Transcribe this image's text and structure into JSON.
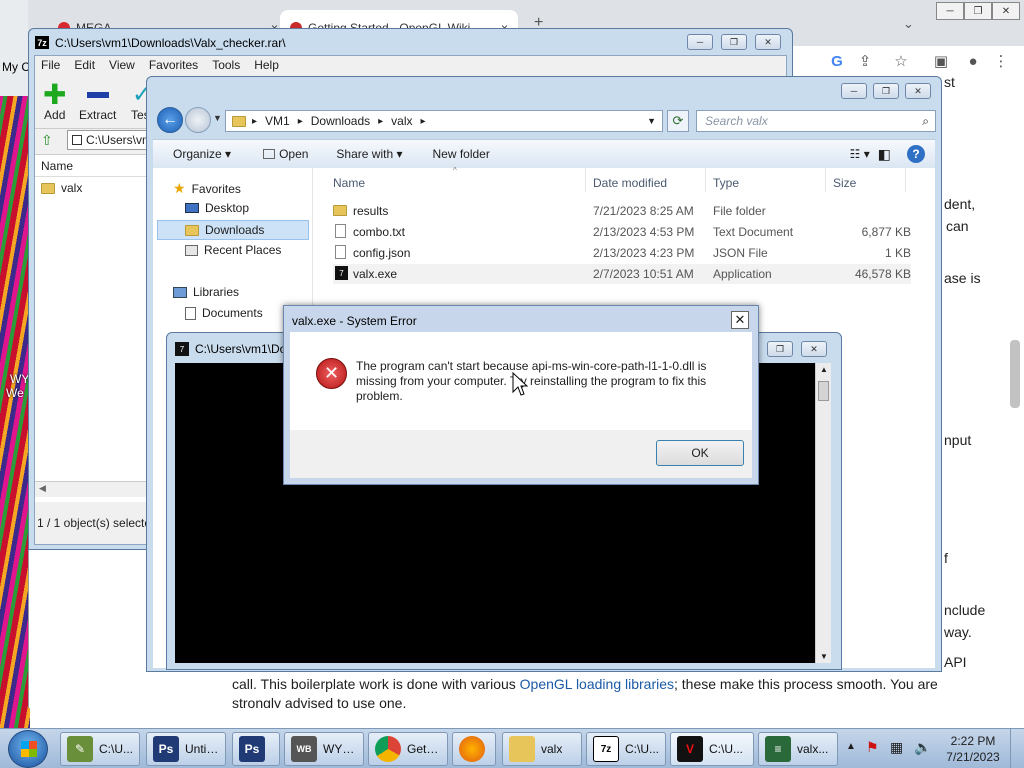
{
  "desktop": {
    "label1": "My C",
    "label2": "WY",
    "label3": "We"
  },
  "chrome": {
    "tab1_title": "MEGA",
    "tab2_title": "Getting Started - OpenGL Wiki",
    "new_tab": "+",
    "page_fragments": [
      "st",
      "dent,",
      "can",
      "ase is",
      "nput",
      "f",
      "nclude",
      "way.",
      "API"
    ],
    "body_line": "call. This boilerplate work is done with various ",
    "body_link": "OpenGL loading libraries",
    "body_line_end": "; these make this process smooth. You are",
    "body_cut": "strongly advised to use one."
  },
  "sevenzip": {
    "title": "C:\\Users\\vm1\\Downloads\\Valx_checker.rar\\",
    "menu": [
      "File",
      "Edit",
      "View",
      "Favorites",
      "Tools",
      "Help"
    ],
    "tools": [
      "Add",
      "Extract",
      "Test"
    ],
    "path": "C:\\Users\\vm",
    "column_name": "Name",
    "item": "valx",
    "status": "1 / 1 object(s) selecte"
  },
  "explorer": {
    "breadcrumb": [
      "VM1",
      "Downloads",
      "valx"
    ],
    "search_placeholder": "Search valx",
    "commands": [
      "Organize",
      "Open",
      "Share with",
      "New folder"
    ],
    "nav": {
      "favorites": "Favorites",
      "desktop": "Desktop",
      "downloads": "Downloads",
      "recent": "Recent Places",
      "libraries": "Libraries",
      "documents": "Documents"
    },
    "columns": [
      "Name",
      "Date modified",
      "Type",
      "Size"
    ],
    "files": [
      {
        "name": "results",
        "date": "7/21/2023 8:25 AM",
        "type": "File folder",
        "size": ""
      },
      {
        "name": "combo.txt",
        "date": "2/13/2023 4:53 PM",
        "type": "Text Document",
        "size": "6,877 KB"
      },
      {
        "name": "config.json",
        "date": "2/13/2023 4:23 PM",
        "type": "JSON File",
        "size": "1 KB"
      },
      {
        "name": "valx.exe",
        "date": "2/7/2023 10:51 AM",
        "type": "Application",
        "size": "46,578 KB"
      }
    ]
  },
  "console": {
    "title": "C:\\Users\\vm1\\Do"
  },
  "dialog": {
    "title": "valx.exe - System Error",
    "message_line1": "The program can't start because api-ms-win-core-path-l1-1-0.dll is",
    "message_line2": "missing from your computer. Try reinstalling the program to fix this",
    "message_line3": "problem.",
    "ok": "OK"
  },
  "taskbar": {
    "items": [
      "C:\\U...",
      "Untit...",
      "",
      "WYS...",
      "Getti...",
      "",
      "valx",
      "C:\\U...",
      "C:\\U...",
      "valx..."
    ],
    "time": "2:22 PM",
    "date": "7/21/2023"
  }
}
